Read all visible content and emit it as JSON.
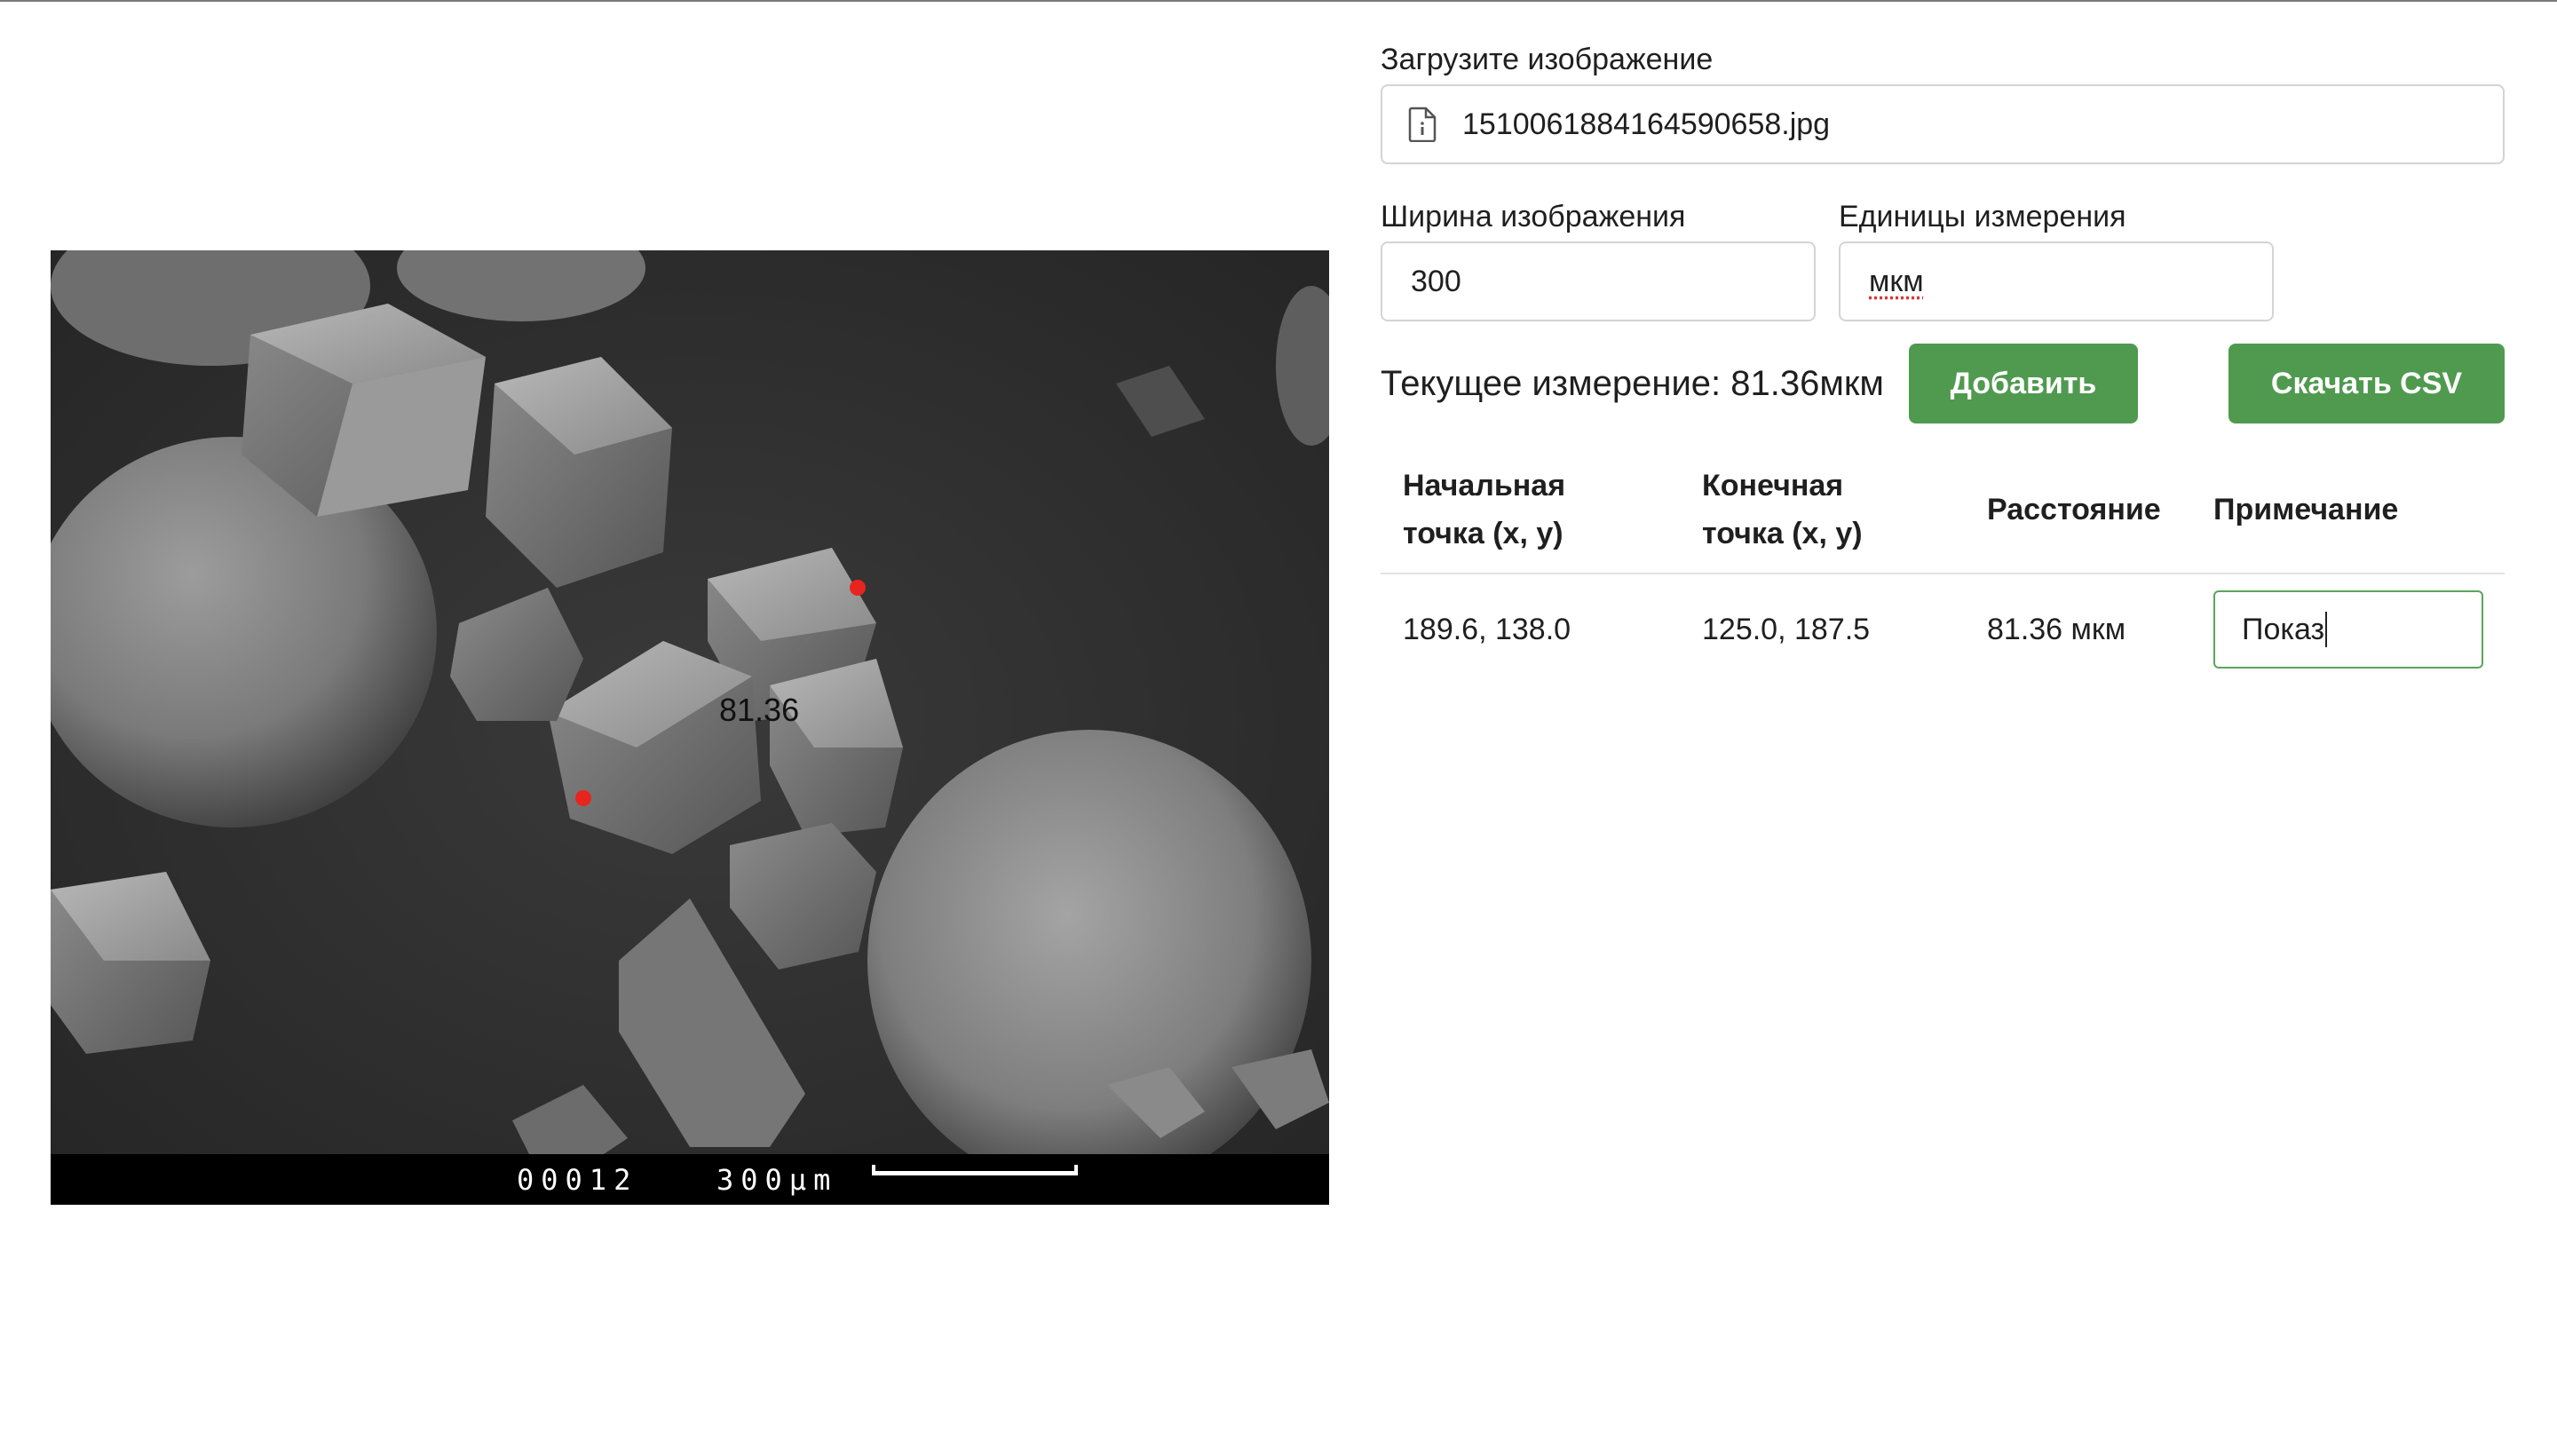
{
  "upload": {
    "label": "Загрузите изображение",
    "filename": "1510061884164590658.jpg",
    "icon": "file-info-icon"
  },
  "image_width": {
    "label": "Ширина изображения",
    "value": "300"
  },
  "units": {
    "label": "Единицы измерения",
    "value": "мкм"
  },
  "current_measurement": "Текущее измерение: 81.36мкм",
  "buttons": {
    "add": "Добавить",
    "download": "Скачать CSV"
  },
  "table": {
    "headers": {
      "start_line1": "Начальная",
      "start_line2": "точка (x, y)",
      "end_line1": "Конечная",
      "end_line2": "точка (x, y)",
      "distance": "Расстояние",
      "note": "Примечание"
    },
    "rows": [
      {
        "start": "189.6, 138.0",
        "end": "125.0, 187.5",
        "distance": "81.36 мкм",
        "note": "Показ"
      }
    ]
  },
  "micrograph": {
    "measure_label": "81.36",
    "scale_code": "00012",
    "scale_text": "300μm",
    "point_color": "#e8241f"
  },
  "colors": {
    "accent": "#4f9a4f",
    "focus_border": "#5aa55a"
  }
}
